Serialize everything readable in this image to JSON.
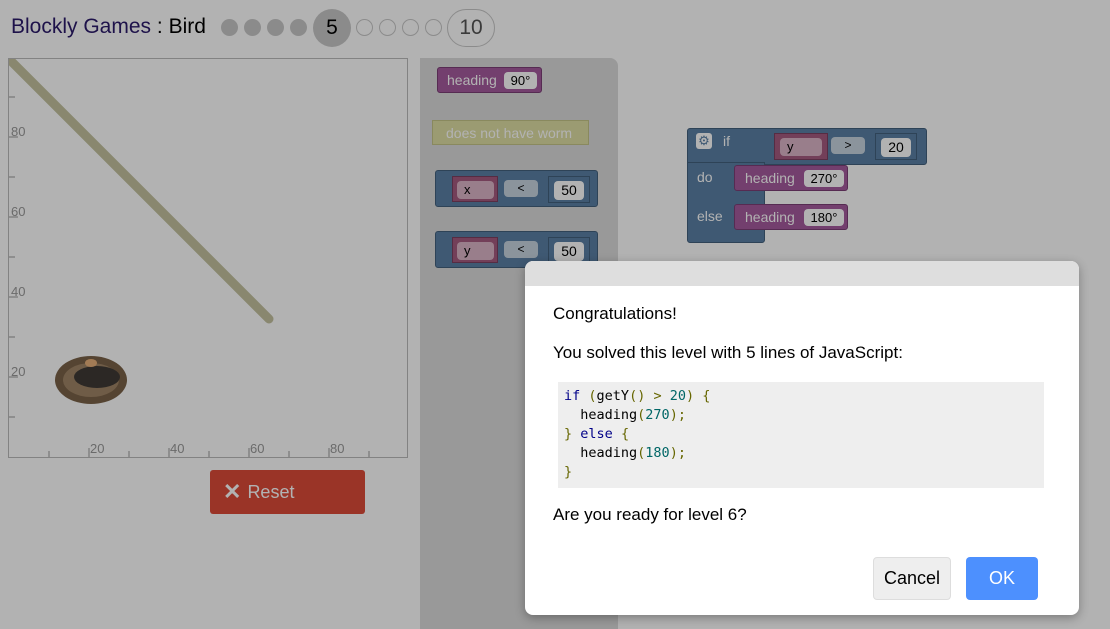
{
  "header": {
    "app_name": "Blockly Games",
    "separator": " : ",
    "game_name": "Bird",
    "levels": [
      "1",
      "2",
      "3",
      "4",
      "5",
      "6",
      "7",
      "8",
      "9",
      "10"
    ],
    "current_level": "5",
    "last_level": "10"
  },
  "canvas": {
    "y_ticks": [
      "80",
      "60",
      "40",
      "20"
    ],
    "x_ticks": [
      "20",
      "40",
      "60",
      "80"
    ]
  },
  "reset_label": "Reset",
  "toolbox": {
    "heading_label": "heading",
    "heading_value": "90°",
    "worm_label": "does not have worm",
    "compare1": {
      "var": "x",
      "op": "<",
      "value": "50"
    },
    "compare2": {
      "var": "y",
      "op": "<",
      "value": "50"
    }
  },
  "workspace": {
    "if_label": "if",
    "do_label": "do",
    "else_label": "else",
    "cond": {
      "var": "y",
      "op": ">",
      "value": "20"
    },
    "do_heading_label": "heading",
    "do_heading_value": "270°",
    "else_heading_label": "heading",
    "else_heading_value": "180°"
  },
  "dialog": {
    "title": "Congratulations!",
    "message": "You solved this level with 5 lines of JavaScript:",
    "question": "Are you ready for level 6?",
    "cancel_label": "Cancel",
    "ok_label": "OK"
  },
  "colors": {
    "reset": "#dd4b39",
    "ok_button": "#4d90fe",
    "heading_block": "#a55b9e",
    "logic_block": "#5b80a5"
  }
}
